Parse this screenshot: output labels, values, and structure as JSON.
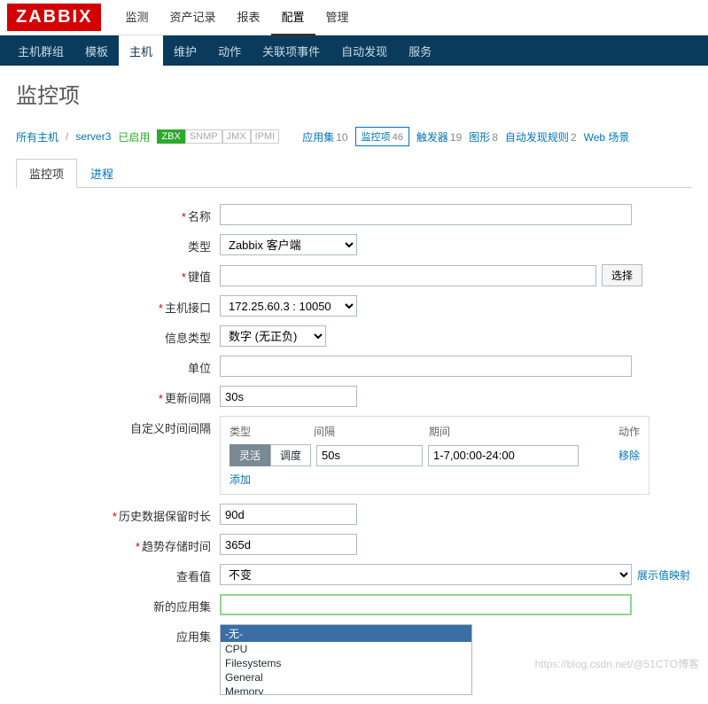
{
  "logo": "ZABBIX",
  "topnav": [
    "监测",
    "资产记录",
    "报表",
    "配置",
    "管理"
  ],
  "topnav_active": 3,
  "subnav": [
    "主机群组",
    "模板",
    "主机",
    "维护",
    "动作",
    "关联项事件",
    "自动发现",
    "服务"
  ],
  "subnav_active": 2,
  "page_title": "监控项",
  "breadcrumb": {
    "all_hosts": "所有主机",
    "host": "server3",
    "enabled": "已启用",
    "proto_badges": [
      "ZBX",
      "SNMP",
      "JMX",
      "IPMI"
    ],
    "links": [
      {
        "label": "应用集",
        "count": 10,
        "active": false
      },
      {
        "label": "监控项",
        "count": 46,
        "active": true
      },
      {
        "label": "触发器",
        "count": 19,
        "active": false
      },
      {
        "label": "图形",
        "count": 8,
        "active": false
      },
      {
        "label": "自动发现规则",
        "count": 2,
        "active": false
      },
      {
        "label": "Web 场景",
        "count": "",
        "active": false
      }
    ]
  },
  "tabs": [
    "监控项",
    "进程"
  ],
  "tabs_active": 0,
  "form": {
    "name": {
      "label": "名称",
      "value": "",
      "required": true
    },
    "type": {
      "label": "类型",
      "value": "Zabbix 客户端"
    },
    "key": {
      "label": "键值",
      "value": "",
      "required": true,
      "select_btn": "选择"
    },
    "interface": {
      "label": "主机接口",
      "value": "172.25.60.3 : 10050",
      "required": true
    },
    "info_type": {
      "label": "信息类型",
      "value": "数字 (无正负)"
    },
    "unit": {
      "label": "单位",
      "value": ""
    },
    "update_interval": {
      "label": "更新间隔",
      "value": "30s",
      "required": true
    },
    "custom_interval": {
      "label": "自定义时间间隔",
      "headers": [
        "类型",
        "间隔",
        "期间",
        "动作"
      ],
      "seg_flexible": "灵活",
      "seg_scheduling": "调度",
      "interval": "50s",
      "period": "1-7,00:00-24:00",
      "remove": "移除",
      "add": "添加"
    },
    "history": {
      "label": "历史数据保留时长",
      "value": "90d",
      "required": true
    },
    "trend": {
      "label": "趋势存储时间",
      "value": "365d",
      "required": true
    },
    "show_value": {
      "label": "查看值",
      "value": "不变",
      "mapping_link": "展示值映射"
    },
    "new_app": {
      "label": "新的应用集",
      "value": ""
    },
    "apps": {
      "label": "应用集",
      "options": [
        "-无-",
        "CPU",
        "Filesystems",
        "General",
        "Memory"
      ],
      "selected": 0
    }
  },
  "watermark": "https://blog.csdn.net/@51CTO博客"
}
